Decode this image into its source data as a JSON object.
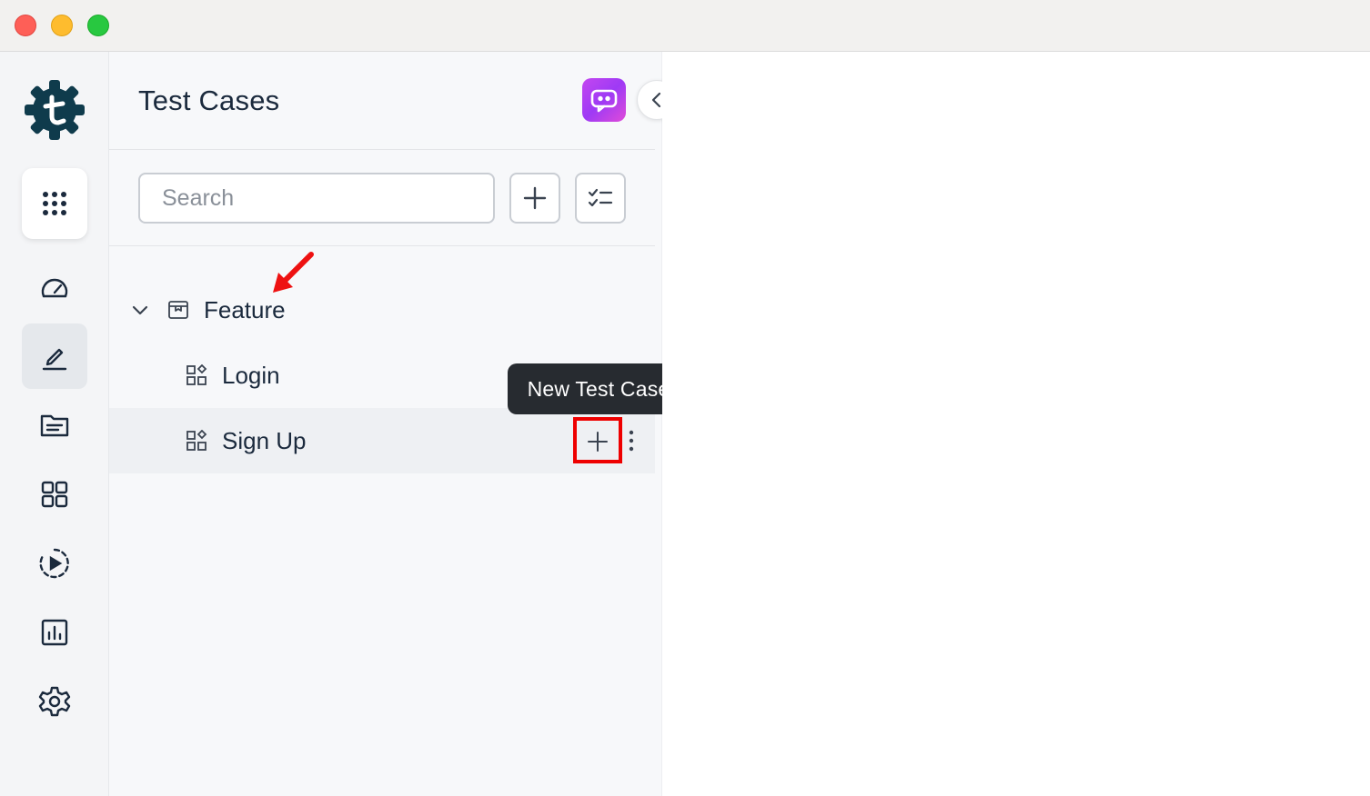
{
  "window": {
    "controls": [
      "close",
      "minimize",
      "maximize"
    ]
  },
  "rail": {
    "logo_icon": "testsigma-gear-logo",
    "items": [
      {
        "name": "apps",
        "icon": "grid-dots-icon"
      },
      {
        "name": "dashboard",
        "icon": "speedometer-icon"
      },
      {
        "name": "test-cases",
        "icon": "pencil-edit-icon",
        "active": true
      },
      {
        "name": "test-data",
        "icon": "folder-icon"
      },
      {
        "name": "elements",
        "icon": "grid-four-icon"
      },
      {
        "name": "runs",
        "icon": "play-circle-icon"
      },
      {
        "name": "reports",
        "icon": "bar-chart-icon"
      },
      {
        "name": "settings",
        "icon": "gear-icon"
      }
    ]
  },
  "panel": {
    "title": "Test Cases",
    "search": {
      "placeholder": "Search",
      "value": ""
    },
    "tree": {
      "root": {
        "label": "Feature",
        "expanded": true
      },
      "children": [
        {
          "label": "Login"
        },
        {
          "label": "Sign Up",
          "selected": true
        }
      ]
    },
    "tooltip": "New Test Case"
  },
  "colors": {
    "text_primary": "#1b2a3d",
    "highlight": "#ee0000",
    "tooltip_bg": "#272b30",
    "bot_gradient_start": "#c447f0",
    "bot_gradient_end": "#e04bd9"
  }
}
